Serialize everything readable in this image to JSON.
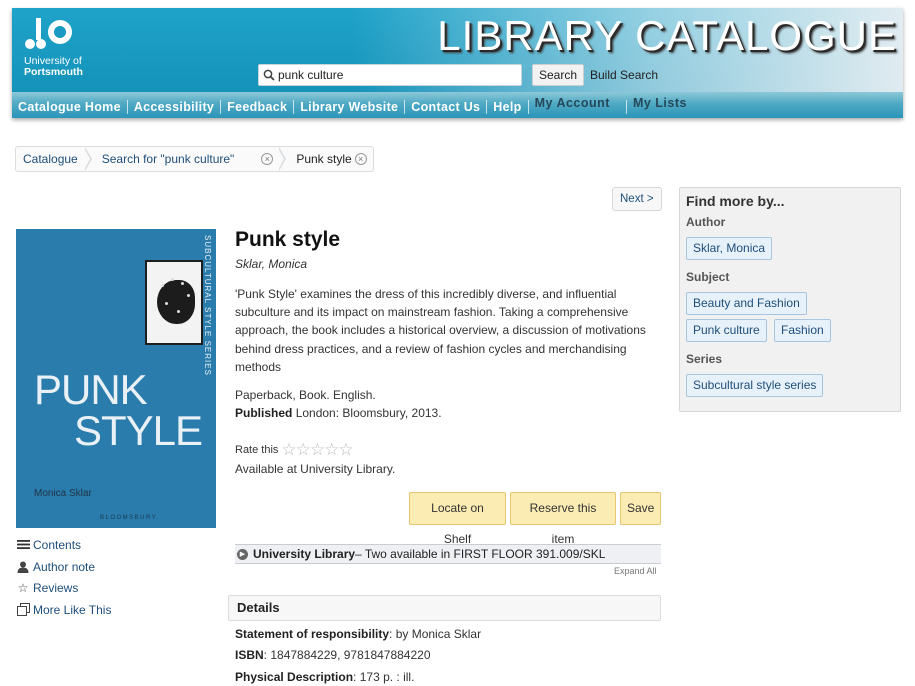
{
  "header": {
    "logo_line1": "University of",
    "logo_line2": "Portsmouth",
    "site_title": "LIBRARY CATALOGUE",
    "search_value": "punk culture",
    "search_button": "Search",
    "build_search": "Build Search",
    "nav": [
      "Catalogue Home",
      "Accessibility",
      "Feedback",
      "Library Website",
      "Contact Us",
      "Help"
    ],
    "my_account": "My Account",
    "my_lists": "My Lists"
  },
  "breadcrumb": {
    "items": [
      "Catalogue",
      "Search for \"punk culture\"",
      "Punk style"
    ]
  },
  "next_label": "Next >",
  "cover": {
    "spine": "SUBCULTURAL STYLE SERIES",
    "line1": "PUNK",
    "line2": "STYLE",
    "author": "Monica Sklar",
    "publisher": "BLOOMSBURY"
  },
  "left_links": [
    {
      "label": "Contents",
      "icon": "list-icon"
    },
    {
      "label": "Author note",
      "icon": "person-icon"
    },
    {
      "label": "Reviews",
      "icon": "star-icon"
    },
    {
      "label": "More Like This",
      "icon": "copy-icon"
    }
  ],
  "record": {
    "title": "Punk style",
    "author": "Sklar, Monica",
    "summary": "'Punk Style' examines the dress of this incredibly diverse, and influential subculture and its impact on mainstream fashion. Taking a comprehensive approach, the book includes a historical overview, a discussion of motivations behind dress practices, and a review of fashion cycles and merchandising methods",
    "format": "Paperback, Book. English.",
    "published_label": "Published",
    "published_value": "London: Bloomsbury, 2013.",
    "rate_label": "Rate this",
    "rating": 0,
    "rating_max": 5,
    "availability": "Available at University Library.",
    "buttons": [
      "Locate on Shelf",
      "Reserve this item",
      "Save"
    ],
    "holding_library": "University Library",
    "holding_detail": " – Two available in FIRST FLOOR 391.009/SKL",
    "expand_all": "Expand All",
    "details_heading": "Details",
    "details": [
      {
        "label": "Statement of responsibility",
        "value": ": by Monica Sklar"
      },
      {
        "label": "ISBN",
        "value": ": 1847884229, 9781847884220"
      },
      {
        "label": "Physical Description",
        "value": ": 173 p. : ill."
      }
    ]
  },
  "sidebar": {
    "title": "Find more by...",
    "author_label": "Author",
    "author_tags": [
      "Sklar, Monica"
    ],
    "subject_label": "Subject",
    "subject_tags": [
      "Beauty and Fashion",
      "Punk culture",
      "Fashion"
    ],
    "series_label": "Series",
    "series_tags": [
      "Subcultural style series"
    ]
  }
}
